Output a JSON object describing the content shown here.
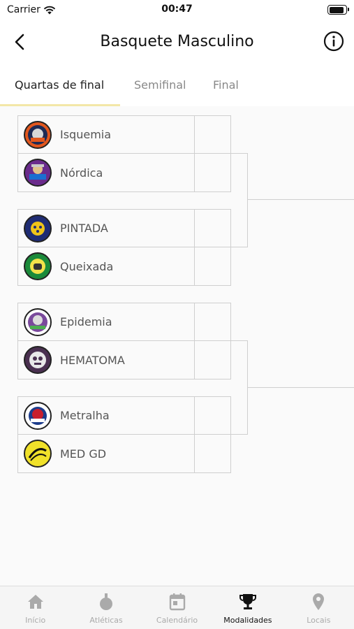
{
  "status_bar": {
    "carrier": "Carrier",
    "time": "00:47",
    "battery_level": 0.9
  },
  "header": {
    "title": "Basquete Masculino"
  },
  "tabs": [
    {
      "label": "Quartas de final",
      "active": true
    },
    {
      "label": "Semifinal",
      "active": false
    },
    {
      "label": "Final",
      "active": false
    }
  ],
  "matches": [
    {
      "home": {
        "name": "Isquemia",
        "score": ""
      },
      "away": {
        "name": "Nórdica",
        "score": ""
      }
    },
    {
      "home": {
        "name": "PINTADA",
        "score": ""
      },
      "away": {
        "name": "Queixada",
        "score": ""
      }
    },
    {
      "home": {
        "name": "Epidemia",
        "score": ""
      },
      "away": {
        "name": "HEMATOMA",
        "score": ""
      }
    },
    {
      "home": {
        "name": "Metralha",
        "score": ""
      },
      "away": {
        "name": "MED GD",
        "score": ""
      }
    }
  ],
  "colors": {
    "accent_tab_indicator": "#f3e7a8",
    "logo_isquemia": "#e2571e",
    "logo_nordica": "#6a2b8c",
    "logo_pintada": "#1f2c74",
    "logo_queixada": "#1b8a3a",
    "logo_epidemia": "#7a4a9c",
    "logo_hematoma": "#4a3050",
    "logo_metralha": "#c81e2e",
    "logo_medgd": "#f0e12a"
  },
  "bottom_nav": [
    {
      "label": "Início",
      "icon": "home-icon",
      "active": false
    },
    {
      "label": "Atléticas",
      "icon": "medal-icon",
      "active": false
    },
    {
      "label": "Calendário",
      "icon": "calendar-icon",
      "active": false
    },
    {
      "label": "Modalidades",
      "icon": "trophy-icon",
      "active": true
    },
    {
      "label": "Locais",
      "icon": "location-pin-icon",
      "active": false
    }
  ]
}
